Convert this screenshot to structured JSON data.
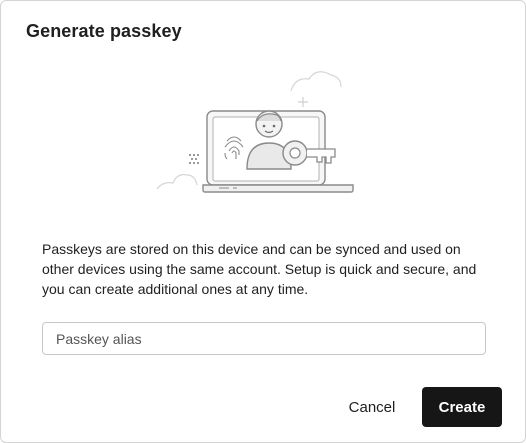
{
  "dialog": {
    "title": "Generate passkey",
    "description": "Passkeys are stored on this device and can be synced and used on other devices using the same account. Setup is quick and secure, and you can create additional ones at any time.",
    "alias_input": {
      "value": "",
      "placeholder": "Passkey alias"
    },
    "buttons": {
      "cancel_label": "Cancel",
      "create_label": "Create"
    }
  },
  "icons": {
    "illustration": "laptop-user-key-illustration"
  },
  "colors": {
    "primary_button": "#161616",
    "text": "#1f1f1f",
    "border": "#c8c8c8"
  }
}
